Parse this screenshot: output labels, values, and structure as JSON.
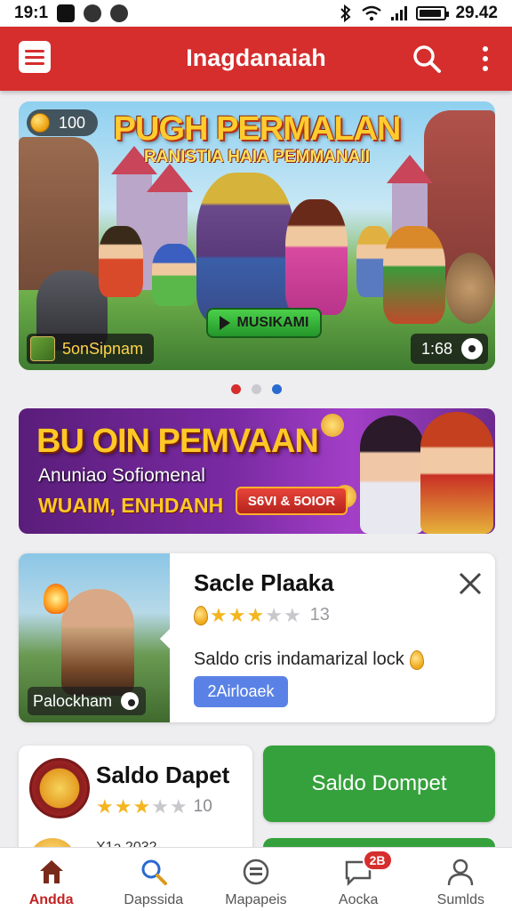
{
  "status_bar": {
    "time": "19:1",
    "clock_right": "29.42",
    "battery_level": 0.9
  },
  "header": {
    "title": "Inagdanaiah"
  },
  "hero": {
    "title": "PUGH PERMALAN",
    "subtitle": "RANISTIA HAIA PEMMANAII",
    "coins": "100",
    "play_label": "MUSIKAMI",
    "game_name": "5onSipnam",
    "time": "1:68",
    "carousel_active_index": 0,
    "carousel_count": 3
  },
  "promo": {
    "title": "BU OIN PEMVAAN",
    "subtitle": "Anuniao Sofiomenal",
    "subtitle2": "WUAIM, ENHDANH",
    "button_label": "S6VI & 5OIOR"
  },
  "card1": {
    "title": "Sacle Plaaka",
    "rating": 3,
    "rating_count": "13",
    "description": "Saldo cris indamarizal lock",
    "tag": "2Airloaek",
    "image_label": "Palockham"
  },
  "card2": {
    "title": "Saldo Dapet",
    "rating": 3,
    "rating_count": "10",
    "peek_text": "X1a 2032"
  },
  "green_button": {
    "label": "Saldo Dompet"
  },
  "bottom_nav": {
    "items": [
      {
        "label": "Andda",
        "icon": "home-icon",
        "active": true
      },
      {
        "label": "Dapssida",
        "icon": "search-icon",
        "active": false
      },
      {
        "label": "Mapapeis",
        "icon": "chat-icon",
        "active": false
      },
      {
        "label": "Aocka",
        "icon": "message-icon",
        "active": false,
        "badge": "2B"
      },
      {
        "label": "Sumlds",
        "icon": "profile-icon",
        "active": false
      }
    ]
  },
  "colors": {
    "accent": "#d62d2d",
    "green": "#35a13c",
    "tag_blue": "#5a82e6",
    "star": "#f4b51e"
  }
}
